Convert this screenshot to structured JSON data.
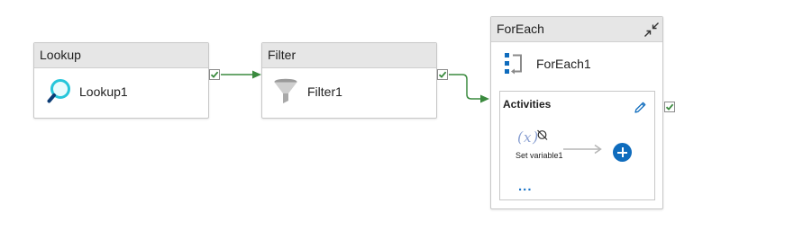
{
  "pipeline": {
    "lookup": {
      "type_label": "Lookup",
      "name": "Lookup1",
      "icon": "lookup-magnifier-icon"
    },
    "filter": {
      "type_label": "Filter",
      "name": "Filter1",
      "icon": "filter-funnel-icon"
    },
    "foreach": {
      "type_label": "ForEach",
      "name": "ForEach1",
      "icon": "foreach-loop-icon",
      "activities_title": "Activities",
      "inner_activity": {
        "name": "Set variable1",
        "icon": "set-variable-icon"
      },
      "more": "..."
    }
  },
  "colors": {
    "success_green": "#3a8a3e",
    "header_gray": "#e6e6e6",
    "accent_blue": "#0f6cbd",
    "icon_cyan": "#26c6da"
  }
}
